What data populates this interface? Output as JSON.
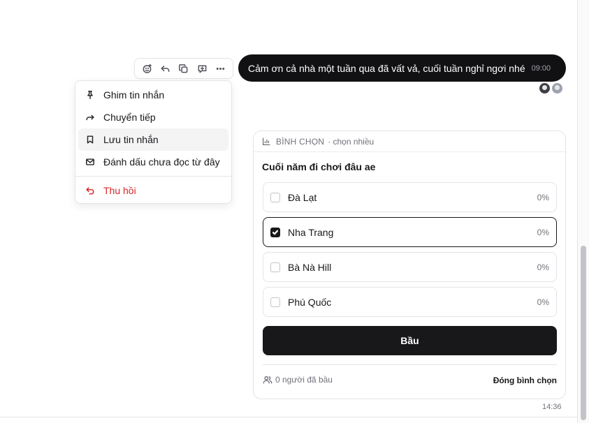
{
  "message": {
    "text": "Cảm ơn cả nhà một tuần qua đã vất vả, cuối tuần nghỉ ngơi nhé",
    "time": "09:00"
  },
  "toolbar": {
    "icons": [
      "emoji-add-icon",
      "reply-icon",
      "copy-icon",
      "quote-icon",
      "more-icon"
    ]
  },
  "context_menu": {
    "items": [
      {
        "label": "Ghim tin nhắn",
        "icon": "pin-icon"
      },
      {
        "label": "Chuyển tiếp",
        "icon": "forward-icon"
      },
      {
        "label": "Lưu tin nhắn",
        "icon": "bookmark-icon",
        "hovered": true
      },
      {
        "label": "Đánh dấu chưa đọc từ đây",
        "icon": "mail-unread-icon"
      }
    ],
    "danger_item": {
      "label": "Thu hồi",
      "icon": "undo-icon",
      "color": "#dc2626"
    }
  },
  "poll": {
    "kind": "BÌNH CHỌN",
    "mode": "· chọn nhiều",
    "question": "Cuối năm đi chơi đâu ae",
    "options": [
      {
        "label": "Đà Lạt",
        "percent": "0%",
        "checked": false
      },
      {
        "label": "Nha Trang",
        "percent": "0%",
        "checked": true
      },
      {
        "label": "Bà Nà Hill",
        "percent": "0%",
        "checked": false
      },
      {
        "label": "Phú Quốc",
        "percent": "0%",
        "checked": false
      }
    ],
    "vote_button": "Bầu",
    "voters": "0 người đã bầu",
    "close_label": "Đóng bình chọn",
    "time": "14:36"
  },
  "colors": {
    "accent": "#18181b",
    "danger": "#dc2626",
    "muted": "#71717a",
    "border": "#e4e4e7"
  }
}
